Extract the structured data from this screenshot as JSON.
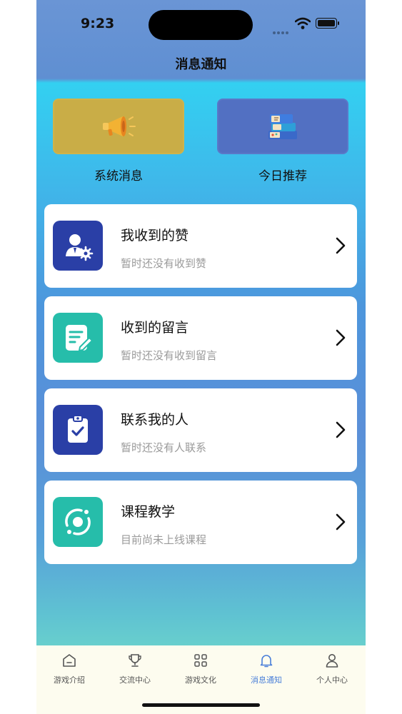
{
  "status_bar": {
    "time": "9:23"
  },
  "nav": {
    "title": "消息通知"
  },
  "quick_actions": [
    {
      "label": "系统消息",
      "icon": "megaphone-icon",
      "color": "#c9ad47"
    },
    {
      "label": "今日推荐",
      "icon": "books-icon",
      "color": "#5270c2"
    }
  ],
  "cards": [
    {
      "title": "我收到的赞",
      "subtitle": "暂时还没有收到赞",
      "icon": "user-settings-icon",
      "color": "#2a3fa6"
    },
    {
      "title": "收到的留言",
      "subtitle": "暂时还没有收到留言",
      "icon": "note-edit-icon",
      "color": "#26bdaa"
    },
    {
      "title": "联系我的人",
      "subtitle": "暂时还没有人联系",
      "icon": "clipboard-check-icon",
      "color": "#2a3fa6"
    },
    {
      "title": "课程教学",
      "subtitle": "目前尚未上线课程",
      "icon": "orbit-icon",
      "color": "#26bdaa"
    }
  ],
  "tabs": [
    {
      "label": "游戏介绍",
      "icon": "home-icon"
    },
    {
      "label": "交流中心",
      "icon": "trophy-icon"
    },
    {
      "label": "游戏文化",
      "icon": "grid-icon"
    },
    {
      "label": "消息通知",
      "icon": "bell-icon",
      "active": true
    },
    {
      "label": "个人中心",
      "icon": "person-icon"
    }
  ],
  "colors": {
    "active_tab": "#4a7fd9",
    "accent_blue": "#2a3fa6",
    "accent_teal": "#26bdaa"
  }
}
